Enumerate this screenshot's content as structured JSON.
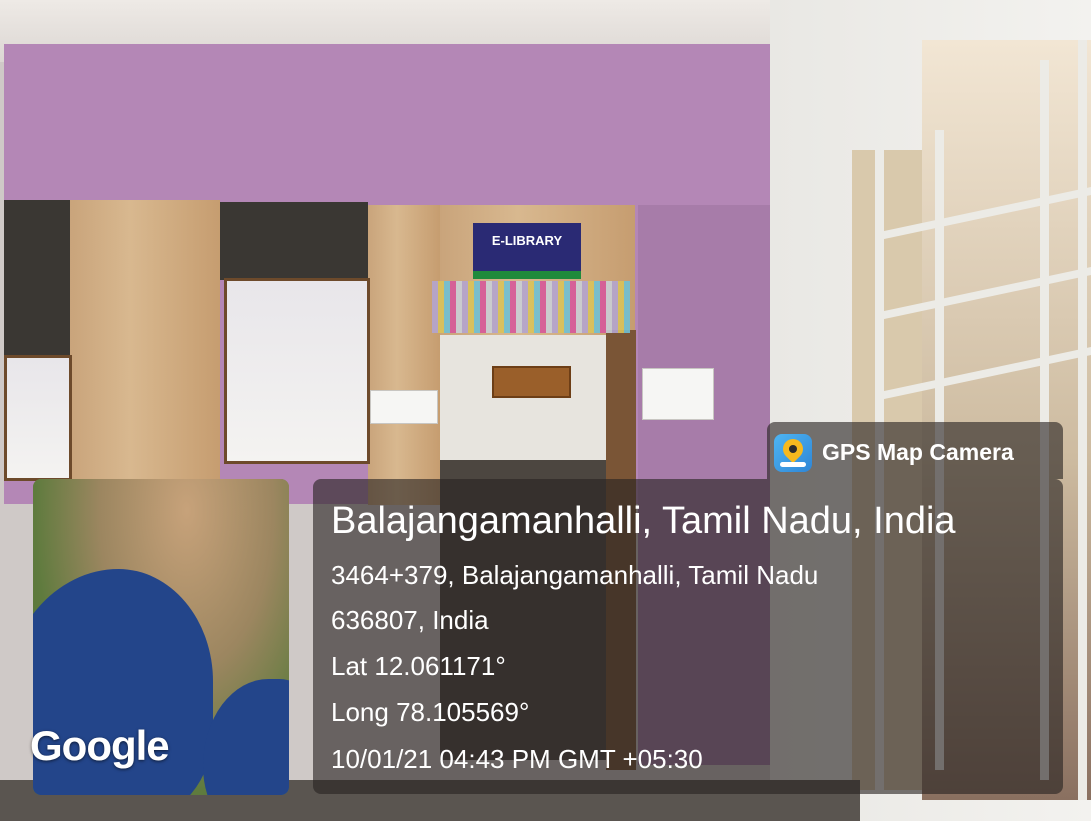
{
  "photo": {
    "sign_text": "E-LIBRARY"
  },
  "overlay": {
    "app": {
      "icon": "gps-map-camera-icon",
      "title": "GPS Map Camera"
    },
    "place": "Balajangamanhalli, Tamil Nadu, India",
    "address_line1": "3464+379, Balajangamanhalli, Tamil Nadu",
    "address_line2": "636807, India",
    "latitude": "Lat 12.061171°",
    "longitude": "Long 78.105569°",
    "datetime": "10/01/21 04:43 PM GMT +05:30",
    "map_attribution": "Google"
  }
}
